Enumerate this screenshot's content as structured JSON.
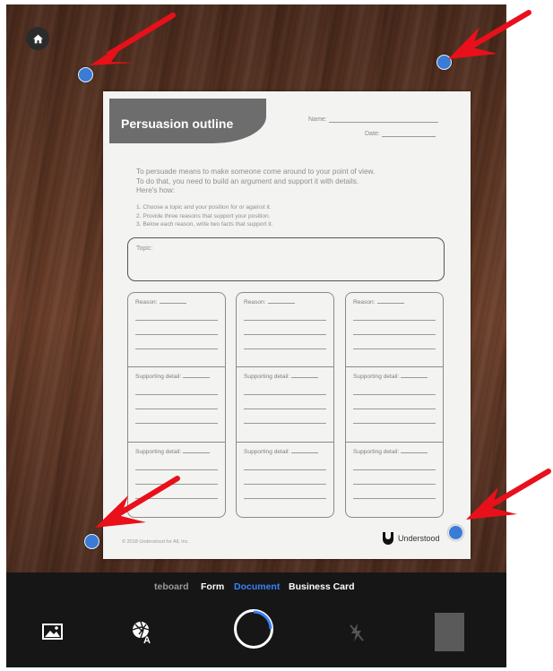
{
  "document": {
    "title": "Persuasion outline",
    "name_label": "Name:",
    "date_label": "Date:",
    "intro_lines": [
      "To persuade means to make someone come around to your point of view.",
      "To do that, you need to build an argument and support it with details.",
      "Here's how:"
    ],
    "steps": [
      "1.  Choose a topic and your position for or against it.",
      "2.  Provide three reasons that support your position.",
      "3.  Below each reason, write two facts that support it."
    ],
    "topic_label": "Topic:",
    "columns": [
      {
        "reason_label": "Reason:",
        "detail1_label": "Supporting detail:",
        "detail2_label": "Supporting detail:"
      },
      {
        "reason_label": "Reason:",
        "detail1_label": "Supporting detail:",
        "detail2_label": "Supporting detail:"
      },
      {
        "reason_label": "Reason:",
        "detail1_label": "Supporting detail:",
        "detail2_label": "Supporting detail:"
      }
    ],
    "copyright": "© 2018 Understood for All, Inc.",
    "brand": "Understood"
  },
  "modes": {
    "whiteboard": "teboard",
    "form": "Form",
    "document": "Document",
    "business_card": "Business Card",
    "active": "Document"
  },
  "icons": {
    "home": "home-icon",
    "gallery": "image-gallery-icon",
    "filter": "aperture-auto-icon",
    "flash": "flash-off-icon"
  },
  "colors": {
    "handle": "#3a7bd5",
    "arrow": "#e8101a",
    "active_mode": "#3a82f7",
    "toolbar": "#161616"
  }
}
